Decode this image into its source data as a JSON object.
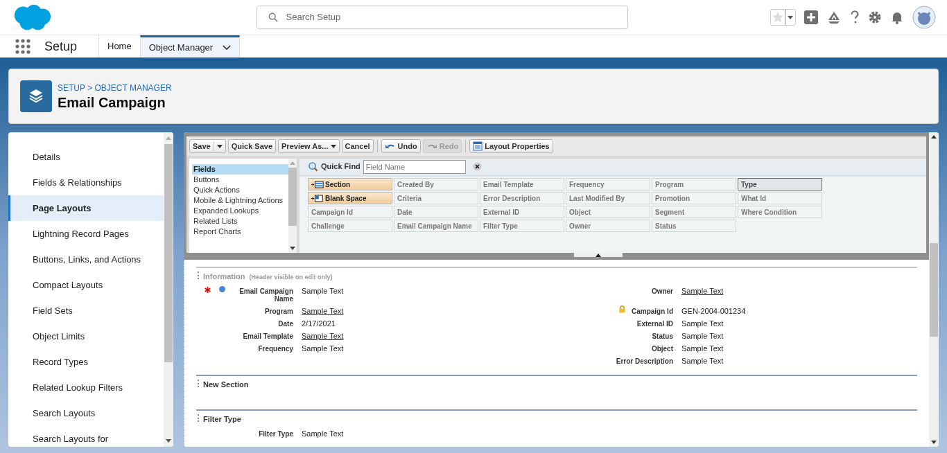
{
  "header": {
    "search": {
      "placeholder": "Search Setup"
    }
  },
  "nav": {
    "app_name": "Setup",
    "tabs": [
      {
        "label": "Home",
        "selected": false,
        "menu": false
      },
      {
        "label": "Object Manager",
        "selected": true,
        "menu": true
      }
    ]
  },
  "page_header": {
    "breadcrumb": "SETUP > OBJECT MANAGER",
    "title": "Email Campaign"
  },
  "sidebar": {
    "items": [
      {
        "label": "Details",
        "selected": false
      },
      {
        "label": "Fields & Relationships",
        "selected": false
      },
      {
        "label": "Page Layouts",
        "selected": true
      },
      {
        "label": "Lightning Record Pages",
        "selected": false
      },
      {
        "label": "Buttons, Links, and Actions",
        "selected": false
      },
      {
        "label": "Compact Layouts",
        "selected": false
      },
      {
        "label": "Field Sets",
        "selected": false
      },
      {
        "label": "Object Limits",
        "selected": false
      },
      {
        "label": "Record Types",
        "selected": false
      },
      {
        "label": "Related Lookup Filters",
        "selected": false
      },
      {
        "label": "Search Layouts",
        "selected": false
      },
      {
        "label": "Search Layouts for",
        "selected": false
      }
    ]
  },
  "toolbar": [
    {
      "label": "Save",
      "kind": "split",
      "disabled": false
    },
    {
      "label": "Quick Save",
      "kind": "plain",
      "disabled": false
    },
    {
      "label": "Preview As...",
      "kind": "menu",
      "disabled": false
    },
    {
      "label": "Cancel",
      "kind": "plain",
      "disabled": false
    },
    {
      "kind": "divider"
    },
    {
      "label": "Undo",
      "kind": "undo",
      "disabled": false
    },
    {
      "label": "Redo",
      "kind": "redo",
      "disabled": true
    },
    {
      "kind": "divider"
    },
    {
      "label": "Layout Properties",
      "kind": "properties",
      "disabled": false
    }
  ],
  "palette": {
    "categories": [
      {
        "label": "Fields",
        "selected": true
      },
      {
        "label": "Buttons",
        "selected": false
      },
      {
        "label": "Quick Actions",
        "selected": false
      },
      {
        "label": "Mobile & Lightning Actions",
        "selected": false
      },
      {
        "label": "Expanded Lookups",
        "selected": false
      },
      {
        "label": "Related Lists",
        "selected": false
      },
      {
        "label": "Report Charts",
        "selected": false
      }
    ],
    "quick_find": {
      "label": "Quick Find",
      "placeholder": "Field Name"
    },
    "items": [
      {
        "label": "Section",
        "kind": "section",
        "selected": false
      },
      {
        "label": "Created By",
        "kind": "field",
        "selected": false
      },
      {
        "label": "Email Template",
        "kind": "field",
        "selected": false
      },
      {
        "label": "Frequency",
        "kind": "field",
        "selected": false
      },
      {
        "label": "Program",
        "kind": "field",
        "selected": false
      },
      {
        "label": "Type",
        "kind": "field",
        "selected": true
      },
      {
        "label": "Blank Space",
        "kind": "blank",
        "selected": false
      },
      {
        "label": "Criteria",
        "kind": "field",
        "selected": false
      },
      {
        "label": "Error Description",
        "kind": "field",
        "selected": false
      },
      {
        "label": "Last Modified By",
        "kind": "field",
        "selected": false
      },
      {
        "label": "Promotion",
        "kind": "field",
        "selected": false
      },
      {
        "label": "What Id",
        "kind": "field",
        "selected": false
      },
      {
        "label": "Campaign Id",
        "kind": "field",
        "selected": false
      },
      {
        "label": "Date",
        "kind": "field",
        "selected": false
      },
      {
        "label": "External ID",
        "kind": "field",
        "selected": false
      },
      {
        "label": "Object",
        "kind": "field",
        "selected": false
      },
      {
        "label": "Segment",
        "kind": "field",
        "selected": false
      },
      {
        "label": "Where Condition",
        "kind": "field",
        "selected": false
      },
      {
        "label": "Challenge",
        "kind": "field",
        "selected": false
      },
      {
        "label": "Email Campaign Name",
        "kind": "field",
        "selected": false
      },
      {
        "label": "Filter Type",
        "kind": "field",
        "selected": false
      },
      {
        "label": "Owner",
        "kind": "field",
        "selected": false
      },
      {
        "label": "Status",
        "kind": "field",
        "selected": false
      }
    ]
  },
  "layout": {
    "sections": [
      {
        "title": "Information",
        "note": "(Header visible on edit only)",
        "left": [
          {
            "label": "Email Campaign Name",
            "value": "Sample Text",
            "link": false,
            "required": true,
            "marker": true,
            "locked": false
          },
          {
            "label": "Program",
            "value": "Sample Text",
            "link": true,
            "required": false,
            "marker": false,
            "locked": false
          },
          {
            "label": "Date",
            "value": "2/17/2021",
            "link": false,
            "required": false,
            "marker": false,
            "locked": false
          },
          {
            "label": "Email Template",
            "value": "Sample Text",
            "link": true,
            "required": false,
            "marker": false,
            "locked": false
          },
          {
            "label": "Frequency",
            "value": "Sample Text",
            "link": false,
            "required": false,
            "marker": false,
            "locked": false
          }
        ],
        "right": [
          {
            "label": "Owner",
            "value": "Sample Text",
            "link": true,
            "required": false,
            "marker": false,
            "locked": false
          },
          {
            "label": "Campaign Id",
            "value": "GEN-2004-001234",
            "link": false,
            "required": false,
            "marker": false,
            "locked": true
          },
          {
            "label": "External ID",
            "value": "Sample Text",
            "link": false,
            "required": false,
            "marker": false,
            "locked": false
          },
          {
            "label": "Status",
            "value": "Sample Text",
            "link": false,
            "required": false,
            "marker": false,
            "locked": false
          },
          {
            "label": "Object",
            "value": "Sample Text",
            "link": false,
            "required": false,
            "marker": false,
            "locked": false
          },
          {
            "label": "Error Description",
            "value": "Sample Text",
            "link": false,
            "required": false,
            "marker": false,
            "locked": false
          }
        ]
      },
      {
        "title": "New Section"
      },
      {
        "title": "Filter Type",
        "left": [
          {
            "label": "Filter Type",
            "value": "Sample Text",
            "link": false,
            "required": false,
            "marker": false,
            "locked": false
          }
        ]
      }
    ]
  }
}
